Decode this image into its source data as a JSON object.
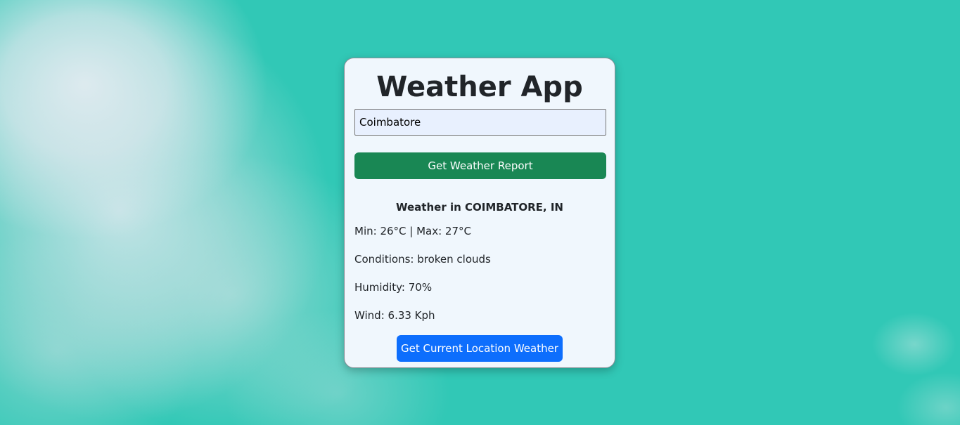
{
  "app": {
    "title": "Weather App"
  },
  "search": {
    "value": "Coimbatore",
    "button_label": "Get Weather Report"
  },
  "report": {
    "heading": "Weather in COIMBATORE, IN",
    "min_max": "Min: 26°C | Max: 27°C",
    "conditions": "Conditions: broken clouds",
    "humidity": "Humidity: 70%",
    "wind": "Wind: 6.33 Kph"
  },
  "location": {
    "button_label": "Get Current Location Weather"
  },
  "colors": {
    "background": "#31c8b6",
    "card": "#f0f7fd",
    "primary_button": "#198754",
    "location_button": "#0d6efd"
  }
}
